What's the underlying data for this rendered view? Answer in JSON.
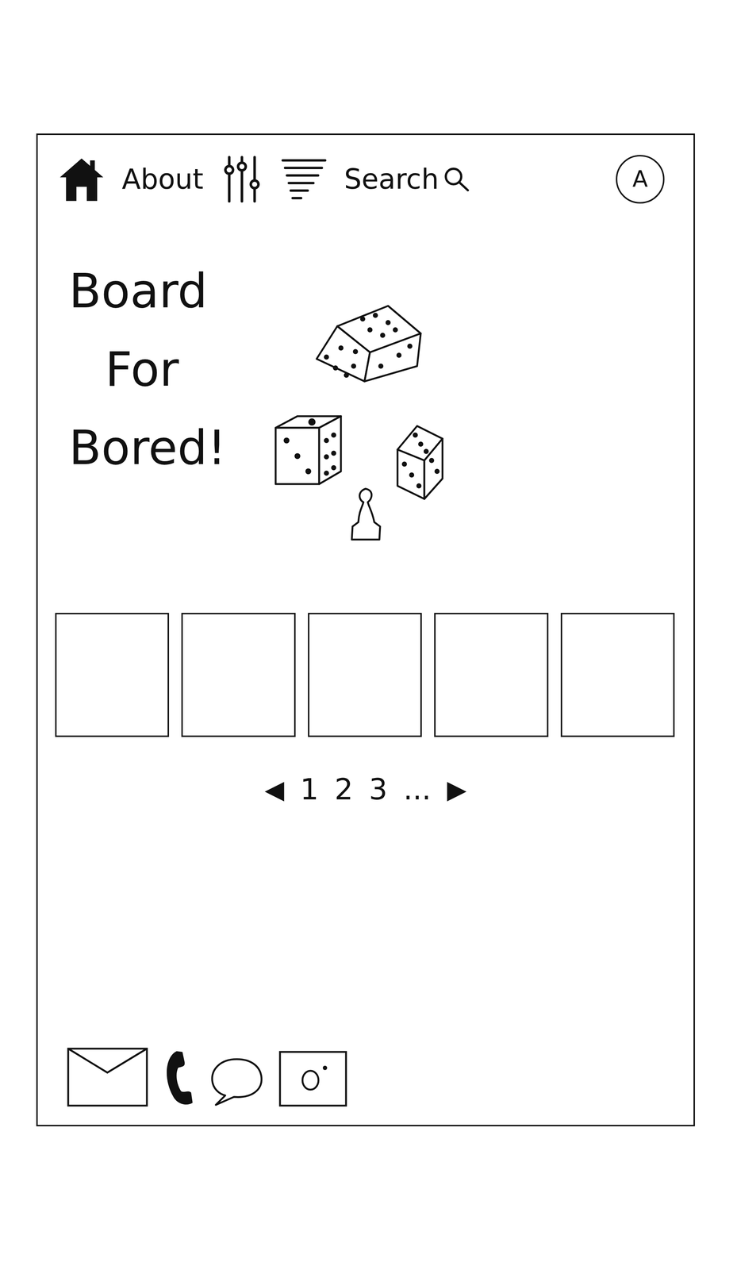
{
  "nav": {
    "about": "About",
    "search": "Search",
    "avatar": "A"
  },
  "hero": {
    "title_lines": [
      "Board",
      "For",
      "Bored!"
    ]
  },
  "cards": [
    {},
    {},
    {},
    {},
    {}
  ],
  "pagination": {
    "prev": "◀",
    "pages": [
      "1",
      "2",
      "3"
    ],
    "more": "...",
    "next": "▶"
  }
}
